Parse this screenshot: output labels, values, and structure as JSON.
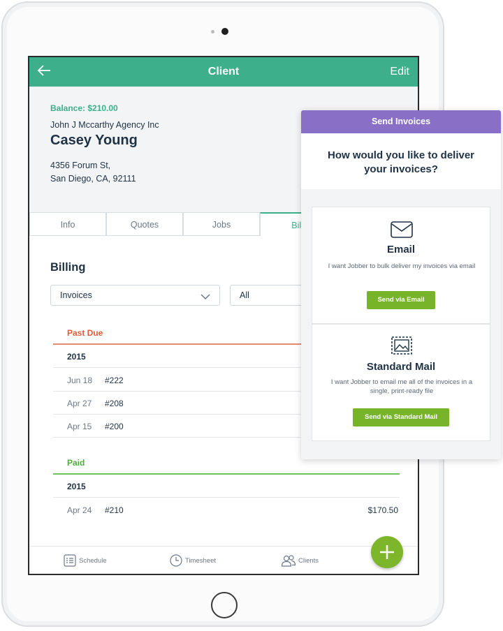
{
  "app": {
    "title": "Client",
    "back_icon": "arrow-left-icon",
    "edit_label": "Edit",
    "accent_color": "#3daf8a"
  },
  "client": {
    "balance": "Balance: $210.00",
    "company": "John J Mccarthy Agency Inc",
    "name": "Casey Young",
    "address_line1": "4356 Forum St,",
    "address_line2": "San Diego, CA, 92111"
  },
  "tabs": [
    {
      "label": "Info"
    },
    {
      "label": "Quotes"
    },
    {
      "label": "Jobs"
    },
    {
      "label": "Billi"
    }
  ],
  "billing": {
    "title": "Billing",
    "type_select": "Invoices",
    "filter_select": "All",
    "past_due": {
      "label": "Past Due",
      "color": "#e05a3a",
      "year": "2015",
      "rows": [
        {
          "date": "Jun 18",
          "number": "#222"
        },
        {
          "date": "Apr 27",
          "number": "#208"
        },
        {
          "date": "Apr 15",
          "number": "#200"
        }
      ]
    },
    "paid": {
      "label": "Paid",
      "color": "#4caf3a",
      "year": "2015",
      "rows": [
        {
          "date": "Apr 24",
          "number": "#210",
          "amount": "$170.50"
        }
      ]
    }
  },
  "bottom_nav": [
    {
      "label": "Schedule",
      "icon": "schedule-icon"
    },
    {
      "label": "Timesheet",
      "icon": "clock-icon"
    },
    {
      "label": "Clients",
      "icon": "people-icon"
    }
  ],
  "fab": {
    "icon": "plus-icon",
    "color": "#7db62a"
  },
  "send_invoices": {
    "header": "Send Invoices",
    "header_color": "#8a6fc7",
    "question": "How would you like to deliver your invoices?",
    "email": {
      "icon": "envelope-icon",
      "title": "Email",
      "description": "I want Jobber to bulk deliver my invoices via email",
      "button": "Send via Email"
    },
    "mail": {
      "icon": "stamp-icon",
      "title": "Standard Mail",
      "description": "I want Jobber to email me all of the invoices in a single, print-ready file",
      "button": "Send via Standard Mail"
    }
  }
}
